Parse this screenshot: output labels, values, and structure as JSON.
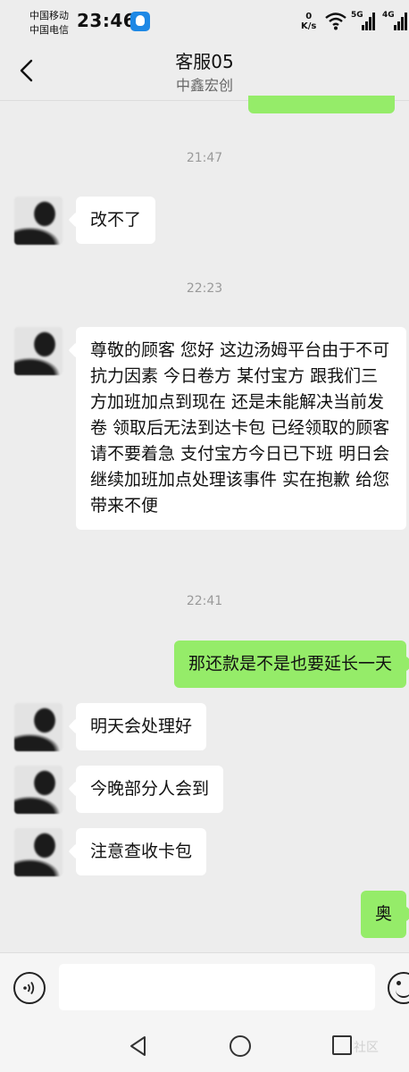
{
  "status_bar": {
    "carrier_1": "中国移动",
    "carrier_2": "中国电信",
    "time": "23:46",
    "net_speed_value": "0",
    "net_speed_unit": "K/s",
    "sig_5g": "5G",
    "sig_4g": "4G"
  },
  "header": {
    "title": "客服05",
    "subtitle": "中鑫宏创"
  },
  "messages": [
    {
      "type": "time",
      "text": "21:47"
    },
    {
      "type": "received",
      "text": "改不了"
    },
    {
      "type": "time",
      "text": "22:23"
    },
    {
      "type": "received",
      "text": "尊敬的顾客 您好 这边汤姆平台由于不可抗力因素 今日卷方 某付宝方 跟我们三方加班加点到现在 还是未能解决当前发卷 领取后无法到达卡包 已经领取的顾客 请不要着急 支付宝方今日已下班 明日会继续加班加点处理该事件 实在抱歉 给您带来不便"
    },
    {
      "type": "time",
      "text": "22:41"
    },
    {
      "type": "sent",
      "text": "那还款是不是也要延长一天"
    },
    {
      "type": "received",
      "text": "明天会处理好"
    },
    {
      "type": "received",
      "text": "今晚部分人会到"
    },
    {
      "type": "received",
      "text": "注意查收卡包"
    },
    {
      "type": "sent",
      "text": "奥"
    }
  ],
  "input_bar": {
    "placeholder": ""
  },
  "icons": {
    "back": "chevron-left-icon",
    "voice": "voice-icon",
    "emoji": "emoji-icon",
    "nav_back": "triangle-back-icon",
    "nav_home": "circle-home-icon",
    "nav_recent": "square-recent-icon"
  },
  "colors": {
    "background": "#ededed",
    "sent_bubble": "#95ec69",
    "received_bubble": "#ffffff",
    "time_label": "#9a9a9a"
  },
  "watermark": "社区"
}
